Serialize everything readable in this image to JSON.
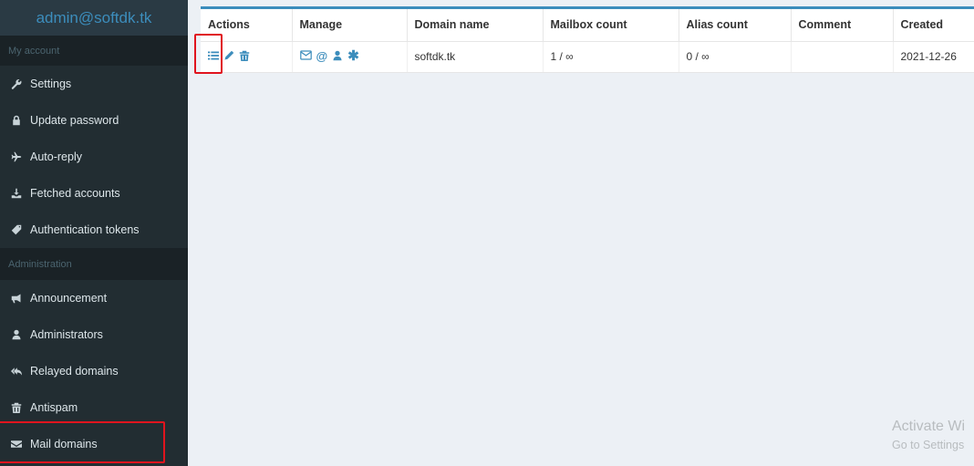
{
  "sidebar": {
    "header": "admin@softdk.tk",
    "sections": [
      {
        "label": "My account",
        "items": [
          {
            "label": "Settings",
            "icon": "wrench-icon"
          },
          {
            "label": "Update password",
            "icon": "lock-icon"
          },
          {
            "label": "Auto-reply",
            "icon": "plane-icon"
          },
          {
            "label": "Fetched accounts",
            "icon": "download-icon"
          },
          {
            "label": "Authentication tokens",
            "icon": "tag-icon"
          }
        ]
      },
      {
        "label": "Administration",
        "items": [
          {
            "label": "Announcement",
            "icon": "bullhorn-icon"
          },
          {
            "label": "Administrators",
            "icon": "user-icon"
          },
          {
            "label": "Relayed domains",
            "icon": "reply-all-icon"
          },
          {
            "label": "Antispam",
            "icon": "trash-icon"
          },
          {
            "label": "Mail domains",
            "icon": "envelope-icon"
          }
        ]
      }
    ]
  },
  "table": {
    "headers": [
      "Actions",
      "Manage",
      "Domain name",
      "Mailbox count",
      "Alias count",
      "Comment",
      "Created"
    ],
    "rows": [
      {
        "domain": "softdk.tk",
        "mailbox_count": "1 / ∞",
        "alias_count": "0 / ∞",
        "comment": "",
        "created": "2021-12-26"
      }
    ]
  },
  "watermark": {
    "line1": "Activate Wi",
    "line2": "Go to Settings"
  },
  "colors": {
    "sidebar_bg": "#222d32",
    "accent": "#3c8dbc",
    "highlight": "#e0141e"
  }
}
